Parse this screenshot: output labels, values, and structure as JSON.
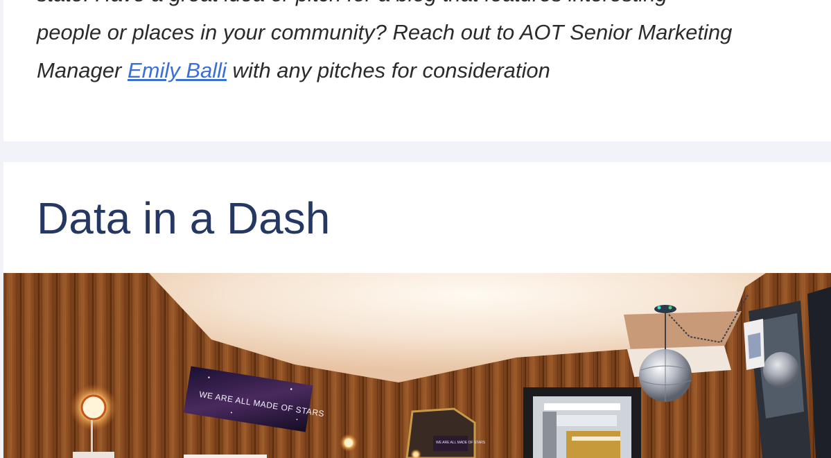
{
  "article": {
    "blurb_line_1": "state. Have a great idea or pitch for a blog that features interesting",
    "blurb_line_2": "people or places in your community? Reach out to AOT Senior Marketing",
    "blurb_line_3_before": "Manager ",
    "contact_link": "Emily Balli",
    "blurb_line_3_after": " with any pitches for consideration"
  },
  "section": {
    "title": "Data in a Dash"
  },
  "photo": {
    "sign_text": "WE ARE ALL MADE OF STARS",
    "sign_text_small": "WE ARE ALL MADE OF STARS"
  },
  "colors": {
    "page_background": "#f2f3f8",
    "card_background": "#ffffff",
    "heading": "#253763",
    "body_text": "#2b2b2b",
    "link": "#3b6fd8"
  }
}
